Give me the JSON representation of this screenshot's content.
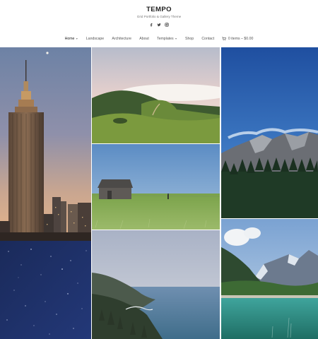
{
  "site": {
    "title": "TEMPO",
    "tagline": "Grid Portfolio & Gallery Theme"
  },
  "social": [
    {
      "icon": "facebook-icon"
    },
    {
      "icon": "twitter-icon"
    },
    {
      "icon": "instagram-icon"
    }
  ],
  "nav": {
    "home": "Home",
    "landscape": "Landscape",
    "architecture": "Architecture",
    "about": "About",
    "templates": "Templates",
    "shop": "Shop",
    "contact": "Contact",
    "cart": "0 items – $0.00"
  },
  "colors": {
    "background": "#ffffff",
    "text": "#222222",
    "muted": "#777777"
  }
}
